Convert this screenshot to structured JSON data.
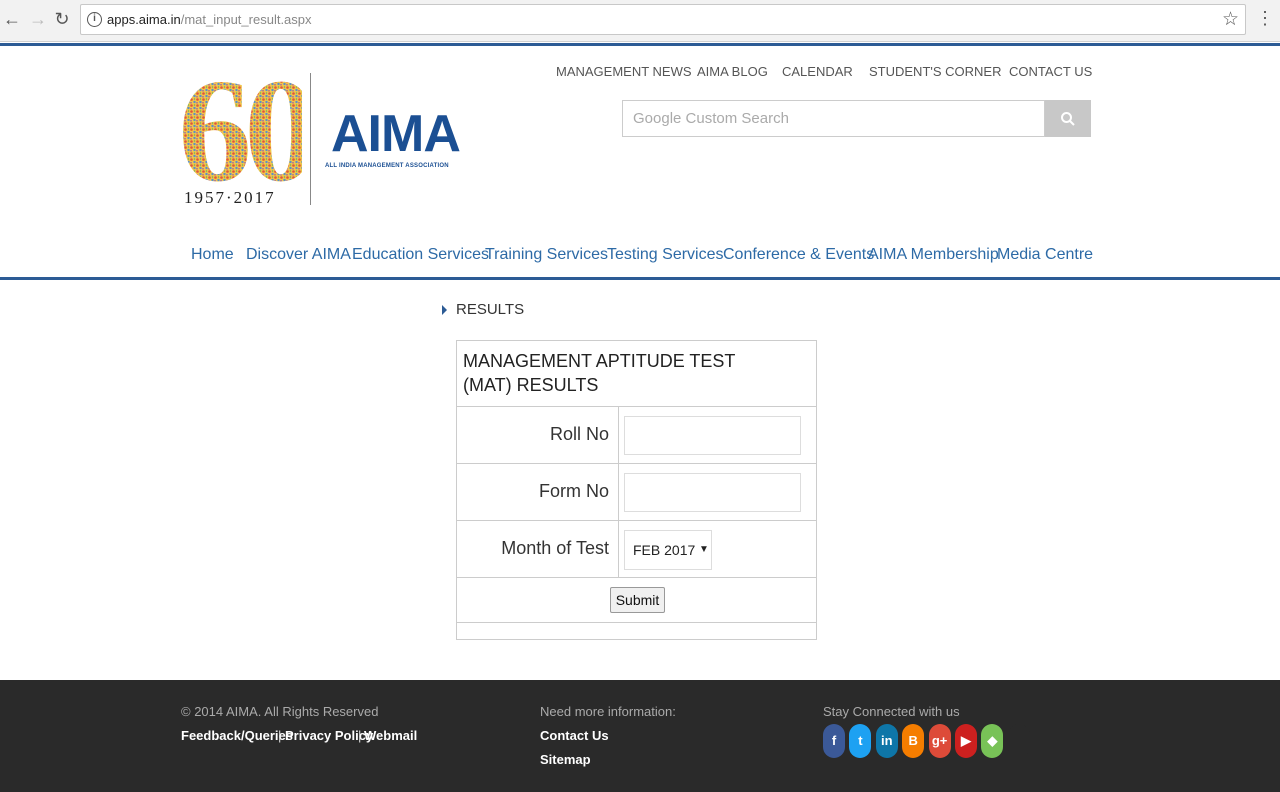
{
  "browser": {
    "url_host": "apps.aima.in",
    "url_path": "/mat_input_result.aspx"
  },
  "header": {
    "logo_years": "1957·2017",
    "logo_number": "60",
    "logo_brand": "AIMA",
    "logo_tagline": "ALL INDIA MANAGEMENT ASSOCIATION",
    "top_links": [
      "MANAGEMENT NEWS",
      "AIMA BLOG",
      "CALENDAR",
      "STUDENT'S CORNER",
      "CONTACT US"
    ],
    "search_placeholder": "Google Custom Search"
  },
  "main_nav": [
    "Home",
    "Discover AIMA",
    "Education Services",
    "Training Services",
    "Testing Services",
    "Conference & Events",
    "AIMA Membership",
    "Media Centre"
  ],
  "results": {
    "heading": "RESULTS",
    "form_title": "MANAGEMENT APTITUDE TEST (MAT) RESULTS",
    "roll_label": "Roll No",
    "roll_value": "",
    "form_label": "Form No",
    "form_value": "",
    "month_label": "Month of Test",
    "month_value": "FEB 2017",
    "submit_label": "Submit"
  },
  "footer": {
    "copyright": "© 2014 AIMA. All Rights Reserved",
    "links": [
      "Feedback/Queries",
      "Privacy Policy",
      "Webmail"
    ],
    "need_info": "Need more information:",
    "contact": "Contact Us",
    "sitemap": "Sitemap",
    "stay_connected": "Stay Connected with us",
    "social": [
      {
        "name": "facebook-icon",
        "glyph": "f",
        "color": "#3b5998"
      },
      {
        "name": "twitter-icon",
        "glyph": "t",
        "color": "#1da1f2"
      },
      {
        "name": "linkedin-icon",
        "glyph": "in",
        "color": "#0e76a8"
      },
      {
        "name": "blogger-icon",
        "glyph": "B",
        "color": "#f57d00"
      },
      {
        "name": "google-plus-icon",
        "glyph": "g+",
        "color": "#dd4b39"
      },
      {
        "name": "youtube-icon",
        "glyph": "▶",
        "color": "#cd201f"
      },
      {
        "name": "android-icon",
        "glyph": "◆",
        "color": "#78c257"
      },
      {
        "name": "apple-icon",
        "glyph": "",
        "color": "#2a2a2a"
      }
    ]
  }
}
